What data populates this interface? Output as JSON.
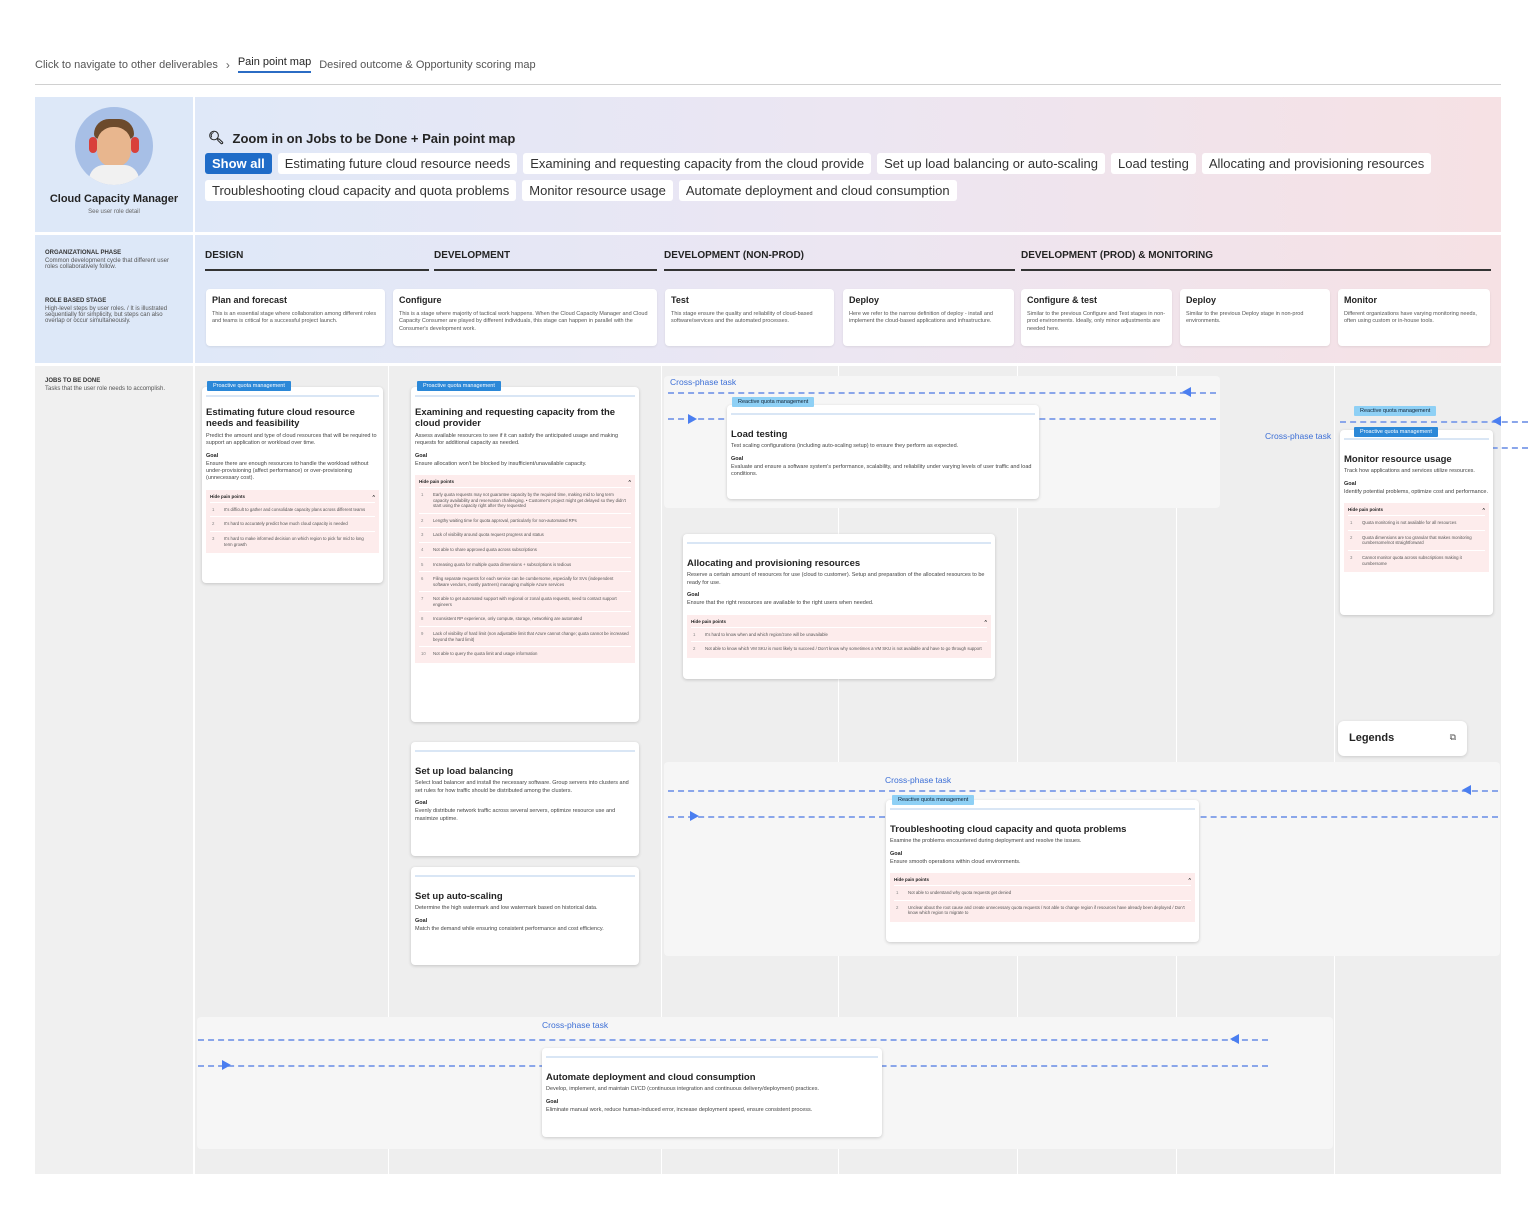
{
  "nav": {
    "prefix": "Click to navigate to other deliverables",
    "active": "Pain point map",
    "other": "Desired outcome & Opportunity scoring map"
  },
  "persona": {
    "name": "Cloud Capacity Manager",
    "link": "See user role detail"
  },
  "hero": {
    "title": "Zoom in on Jobs to be Done + Pain point map",
    "chips": [
      "Show all",
      "Estimating future cloud resource needs",
      "Examining and requesting capacity from the cloud provide",
      "Set up load balancing or auto-scaling",
      "Load testing",
      "Allocating and provisioning resources",
      "Troubleshooting cloud capacity and quota problems",
      "Monitor resource usage",
      "Automate deployment and cloud consumption"
    ]
  },
  "labels": {
    "org_phase_title": "ORGANIZATIONAL PHASE",
    "org_phase_desc": "Common development cycle that different user roles collaboratively follow.",
    "role_stage_title": "ROLE BASED STAGE",
    "role_stage_desc": "High-level steps by user roles. / It is illustrated sequentially for simplicity, but steps can also overlap or occur simultaneously.",
    "jtbd_title": "JOBS TO BE DONE",
    "jtbd_desc": "Tasks that the user role needs to accomplish."
  },
  "phases": [
    "DESIGN",
    "DEVELOPMENT",
    "DEVELOPMENT (NON-PROD)",
    "DEVELOPMENT (PROD) & MONITORING"
  ],
  "stages": [
    {
      "title": "Plan and forecast",
      "desc": "This is an essential stage where collaboration among different roles and teams is critical for a successful project launch."
    },
    {
      "title": "Configure",
      "desc": "This is a stage where majority of tactical work happens. When the Cloud Capacity Manager and Cloud Capacity Consumer are played by different individuals, this stage can happen in parallel with the Consumer's development work."
    },
    {
      "title": "Test",
      "desc": "This stage ensure the quality and reliability of cloud-based software/services and the automated processes."
    },
    {
      "title": "Deploy",
      "desc": "Here we refer to the narrow definition of deploy - install and implement the cloud-based applications and infrastructure."
    },
    {
      "title": "Configure & test",
      "desc": "Similar to the previous Configure and Test stages in non-prod environments. Ideally, only minor adjustments are needed here."
    },
    {
      "title": "Deploy",
      "desc": "Similar to the previous Deploy stage in non-prod environments."
    },
    {
      "title": "Monitor",
      "desc": "Different organizations have varying monitoring needs, often using custom or in-house tools."
    }
  ],
  "tags": {
    "proactive": "Proactive quota management",
    "reactive": "Reactive quota management"
  },
  "cross_phase": "Cross-phase task",
  "goal_label": "Goal",
  "hide_pain": "Hide pain points",
  "cards": {
    "estimating": {
      "title": "Estimating future cloud resource needs and feasibility",
      "desc": "Predict the amount and type of cloud resources that will be required to support an application or workload over time.",
      "goal": "Ensure there are enough resources to handle the workload without under-provisioning (affect performance) or over-provisioning (unnecessary cost).",
      "pains": [
        "It's difficult to gather and consolidate capacity plans across different teams",
        "It's hard to accurately predict how much cloud capacity is needed",
        "It's hard to make informed decision on which region to pick for mid to long term growth"
      ]
    },
    "examining": {
      "title": "Examining and requesting capacity from the cloud provider",
      "desc": "Assess available resources to see if it can satisfy the anticipated usage and making requests for additional capacity as needed.",
      "goal": "Ensure allocation won't be blocked by insufficient/unavailable capacity.",
      "pains": [
        "Early quota requests may not guarantee capacity by the required time, making mid to long term capacity availability and reservation challenging. • Customer's project might get delayed so they didn't start using the capacity right after they requested",
        "Lengthy waiting time for quota approval, particularly for non-automated RPs",
        "Lack of visibility around quota request progress and status",
        "Not able to share approved quota across subscriptions",
        "Increasing quota for multiple quota dimensions + subscriptions is tedious",
        "Filing separate requests for each service can be cumbersome, especially for SVs (independent software vendors, mostly partners) managing multiple Azure services",
        "Not able to get automated support with regional or zonal quota requests, need to contact support engineers",
        "Inconsistent RP experience, only compute, storage, networking are automated",
        "Lack of visibility of hard limit (non adjustable limit that Azure cannot change; quota cannot be increased beyond the hard limit)",
        "Not able to query the quota limit and usage information"
      ]
    },
    "loadbal": {
      "title": "Set up load balancing",
      "desc": "Select load balancer and install the necessary software. Group servers into clusters and set rules for how traffic should be distributed among the clusters.",
      "goal": "Evenly distribute network traffic across several servers, optimize resource use and maximize uptime."
    },
    "autoscale": {
      "title": "Set up auto-scaling",
      "desc": "Determine the high watermark and low watermark based on historical data.",
      "goal": "Match the demand while ensuring consistent performance and cost efficiency."
    },
    "loadtest": {
      "title": "Load testing",
      "desc": "Test scaling configurations (including auto-scaling setup) to ensure they perform as expected.",
      "goal": "Evaluate and ensure a software system's performance, scalability, and reliability under varying levels of user traffic and load conditions."
    },
    "allocating": {
      "title": "Allocating and provisioning resources",
      "desc": "Reserve a certain amount of resources for use (cloud to customer). Setup and preparation of the allocated resources to be ready for use.",
      "goal": "Ensure that the right resources are available to the right users when needed.",
      "pains": [
        "It's hard to know when and which region/zone will be unavailable",
        "Not able to know which VM SKU is most likely to succeed / Don't know why sometimes a VM SKU is not available and have to go through support"
      ]
    },
    "monitor": {
      "title": "Monitor resource usage",
      "desc": "Track how applications and services utilize resources.",
      "goal": "Identify potential problems, optimize cost and performance.",
      "pains": [
        "Quota monitoring is not available for all resources",
        "Quota dimensions are too granular that makes monitoring cumbersome/not straightforward",
        "Cannot monitor quota across subscriptions making it cumbersome"
      ]
    },
    "trouble": {
      "title": "Troubleshooting cloud capacity and quota problems",
      "desc": "Examine the problems encountered during deployment and resolve the issues.",
      "goal": "Ensure smooth operations within cloud environments.",
      "pains": [
        "Not able to understand why quota requests get denied",
        "Unclear about the root cause and create unnecessary quota requests / Not able to change region if resources have already been deployed / Don't know which region to migrate to"
      ]
    },
    "automate": {
      "title": "Automate deployment and cloud consumption",
      "desc": "Develop, implement, and maintain CI/CD (continuous integration and continuous delivery/deployment) practices.",
      "goal": "Eliminate manual work, reduce human-induced error, increase deployment speed, ensure consistent process."
    }
  },
  "legend": {
    "title": "Legends"
  },
  "colors": {
    "accent": "#1f6cc8",
    "pain_bg": "#fdecec",
    "proactive": "#2b88d8",
    "reactive": "#8ed0f5"
  }
}
